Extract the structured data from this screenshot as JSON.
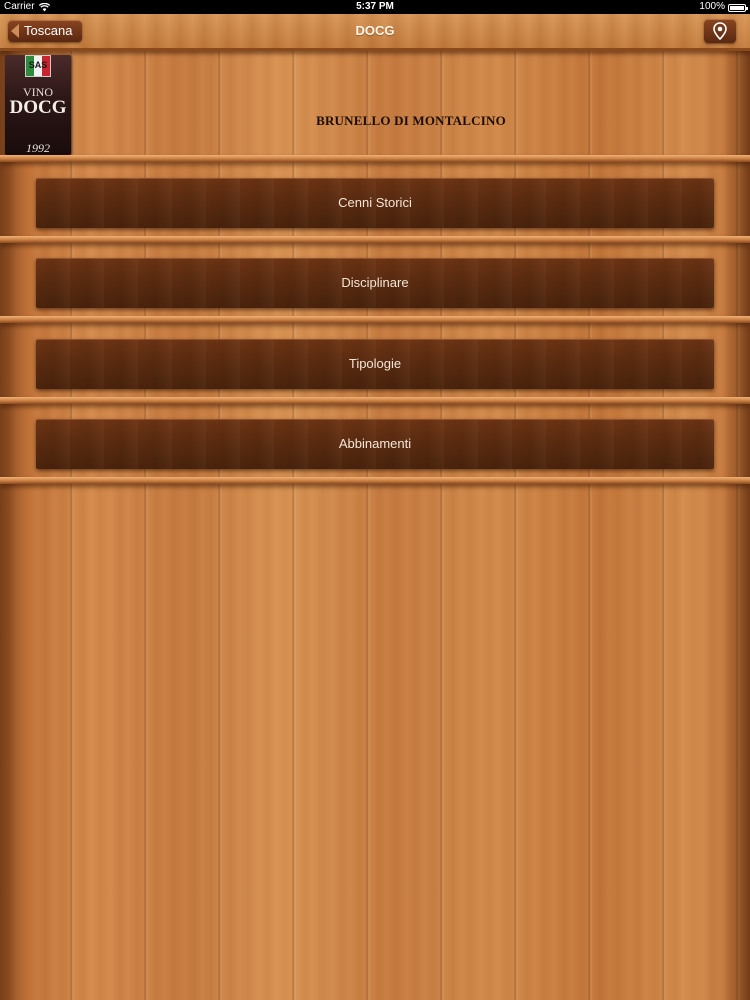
{
  "status_bar": {
    "carrier": "Carrier",
    "time": "5:37 PM",
    "battery": "100%"
  },
  "nav": {
    "back_label": "Toscana",
    "title": "DOCG",
    "map_icon": "location-pin-icon"
  },
  "header": {
    "label_image": {
      "top_text": "VINO",
      "main_text": "DOCG",
      "year": "1992",
      "seal_text": "SAS"
    },
    "title": "BRUNELLO DI MONTALCINO"
  },
  "menu": {
    "items": [
      {
        "label": "Cenni Storici"
      },
      {
        "label": "Disciplinare"
      },
      {
        "label": "Tipologie"
      },
      {
        "label": "Abbinamenti"
      }
    ]
  },
  "colors": {
    "wood_light": "#d48a4c",
    "wood_dark": "#5a2b10",
    "button_text": "#f4e6d6"
  }
}
